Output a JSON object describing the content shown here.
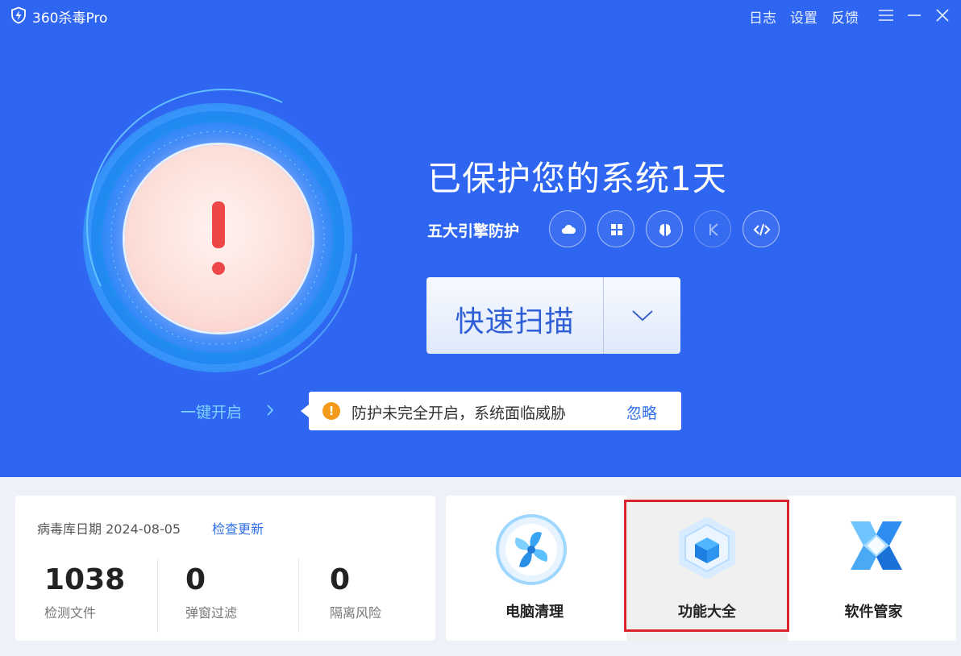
{
  "titlebar": {
    "app_title": "360杀毒Pro",
    "links": {
      "log": "日志",
      "settings": "设置",
      "feedback": "反馈"
    },
    "icons": [
      "shield-logo-icon",
      "menu-icon",
      "minimize-icon",
      "close-icon"
    ]
  },
  "protection": {
    "headline": "已保护您的系统1天",
    "engine_label": "五大引擎防护",
    "engines": [
      "cloud-engine-icon",
      "windows-engine-icon",
      "qvm-ai-engine-icon",
      "k-engine-icon",
      "code-engine-icon"
    ],
    "enable_link": "一键开启",
    "status": "warning"
  },
  "scan": {
    "button_label": "快速扫描"
  },
  "warning": {
    "text": "防护未完全开启，系统面临威胁",
    "ignore_label": "忽略"
  },
  "stats": {
    "db_label": "病毒库日期 2024-08-05",
    "update_label": "检查更新",
    "items": [
      {
        "value": "1038",
        "label": "检测文件"
      },
      {
        "value": "0",
        "label": "弹窗过滤"
      },
      {
        "value": "0",
        "label": "隔离风险"
      }
    ]
  },
  "tools": [
    {
      "label": "电脑清理",
      "icon": "fan-clean-icon"
    },
    {
      "label": "功能大全",
      "icon": "cube-icon",
      "selected": true
    },
    {
      "label": "软件管家",
      "icon": "software-manager-icon"
    }
  ],
  "colors": {
    "hero_bg": "#2f66f1",
    "accent": "#2f6fe8",
    "danger": "#ee4747",
    "warning": "#f39a1b",
    "highlight": "#d9262e"
  }
}
